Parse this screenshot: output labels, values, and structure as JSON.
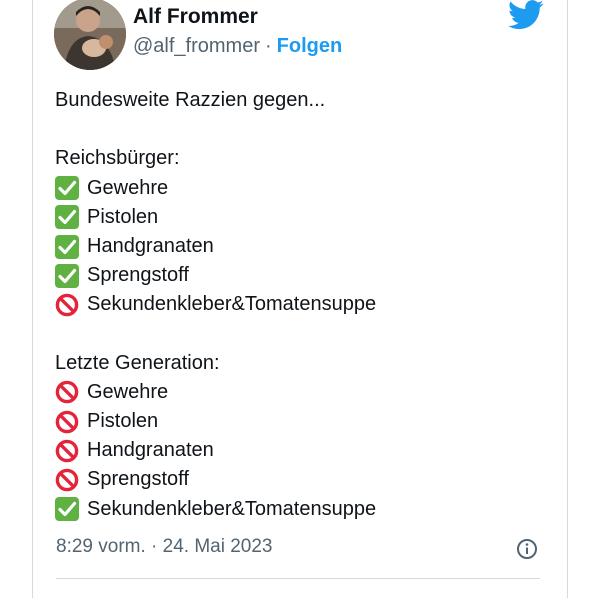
{
  "tweet": {
    "author_name": "Alf Frommer",
    "handle": "@alf_frommer",
    "separator": "·",
    "follow_label": "Folgen",
    "intro": "Bundesweite Razzien gegen...",
    "groups": [
      {
        "heading": "Reichsbürger:",
        "items": [
          {
            "status": "check",
            "text": "Gewehre"
          },
          {
            "status": "check",
            "text": "Pistolen"
          },
          {
            "status": "check",
            "text": "Handgranaten"
          },
          {
            "status": "check",
            "text": "Sprengstoff"
          },
          {
            "status": "prohibited",
            "text": "Sekundenkleber&Tomatensuppe"
          }
        ]
      },
      {
        "heading": "Letzte Generation:",
        "items": [
          {
            "status": "prohibited",
            "text": "Gewehre"
          },
          {
            "status": "prohibited",
            "text": "Pistolen"
          },
          {
            "status": "prohibited",
            "text": "Handgranaten"
          },
          {
            "status": "prohibited",
            "text": "Sprengstoff"
          },
          {
            "status": "check",
            "text": "Sekundenkleber&Tomatensuppe"
          }
        ]
      }
    ],
    "timestamp": "8:29 vorm. · 24. Mai 2023"
  },
  "icons": {
    "brand": "twitter-bird-icon",
    "check": "check-mark-emoji-icon",
    "prohibited": "prohibited-emoji-icon",
    "info": "info-icon"
  },
  "colors": {
    "brand_blue": "#1d9bf0",
    "text": "#0f1419",
    "muted": "#536471",
    "check_green": "#5fb141",
    "prohibited_red": "#e3243a"
  }
}
